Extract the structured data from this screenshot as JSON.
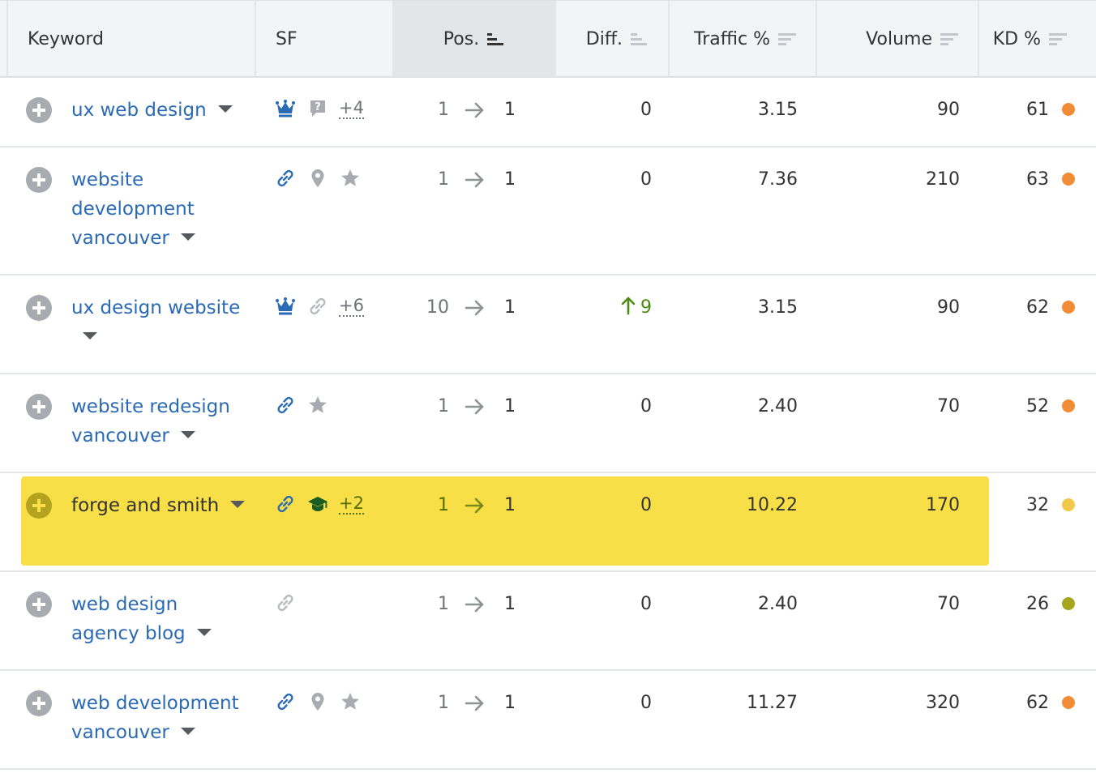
{
  "header": {
    "keyword": "Keyword",
    "sf": "SF",
    "pos": "Pos.",
    "diff": "Diff.",
    "traffic": "Traffic %",
    "volume": "Volume",
    "kd": "KD %"
  },
  "colors": {
    "link": "#2a6ab5",
    "highlight": "#f8df47",
    "kd_orange": "#f28d36",
    "kd_olive": "#a6a51e",
    "kd_yellow": "#f2c84b",
    "diff_up": "#4b8a12"
  },
  "rows": [
    {
      "keyword": "ux web design",
      "sf_icons": [
        "crown-icon",
        "question-icon"
      ],
      "sf_more": "+4",
      "pos_from": "1",
      "pos_to": "1",
      "diff": "0",
      "traffic": "3.15",
      "volume": "90",
      "kd": "61",
      "kd_color": "#f28d36",
      "highlight": false
    },
    {
      "keyword": "website development vancouver",
      "sf_icons": [
        "link-icon",
        "location-pin-icon",
        "star-icon"
      ],
      "sf_more": "",
      "pos_from": "1",
      "pos_to": "1",
      "diff": "0",
      "traffic": "7.36",
      "volume": "210",
      "kd": "63",
      "kd_color": "#f28d36",
      "highlight": false
    },
    {
      "keyword": "ux design website",
      "sf_icons": [
        "crown-icon",
        "link-icon-gray"
      ],
      "sf_more": "+6",
      "pos_from": "10",
      "pos_to": "1",
      "diff": "9",
      "diff_up": true,
      "traffic": "3.15",
      "volume": "90",
      "kd": "62",
      "kd_color": "#f28d36",
      "highlight": false
    },
    {
      "keyword": "website redesign vancouver",
      "sf_icons": [
        "link-icon",
        "star-icon"
      ],
      "sf_more": "",
      "pos_from": "1",
      "pos_to": "1",
      "diff": "0",
      "traffic": "2.40",
      "volume": "70",
      "kd": "52",
      "kd_color": "#f28d36",
      "highlight": false
    },
    {
      "keyword": "forge and smith",
      "sf_icons": [
        "link-icon",
        "graduation-cap-icon"
      ],
      "sf_more": "+2",
      "pos_from": "1",
      "pos_to": "1",
      "diff": "0",
      "traffic": "10.22",
      "volume": "170",
      "kd": "32",
      "kd_color": "#f2c84b",
      "highlight": true
    },
    {
      "keyword": "web design agency blog",
      "sf_icons": [
        "link-icon-gray"
      ],
      "sf_more": "",
      "pos_from": "1",
      "pos_to": "1",
      "diff": "0",
      "traffic": "2.40",
      "volume": "70",
      "kd": "26",
      "kd_color": "#a6a51e",
      "highlight": false
    },
    {
      "keyword": "web development vancouver",
      "sf_icons": [
        "link-icon",
        "location-pin-icon",
        "star-icon"
      ],
      "sf_more": "",
      "pos_from": "1",
      "pos_to": "1",
      "diff": "0",
      "traffic": "11.27",
      "volume": "320",
      "kd": "62",
      "kd_color": "#f28d36",
      "highlight": false
    }
  ]
}
